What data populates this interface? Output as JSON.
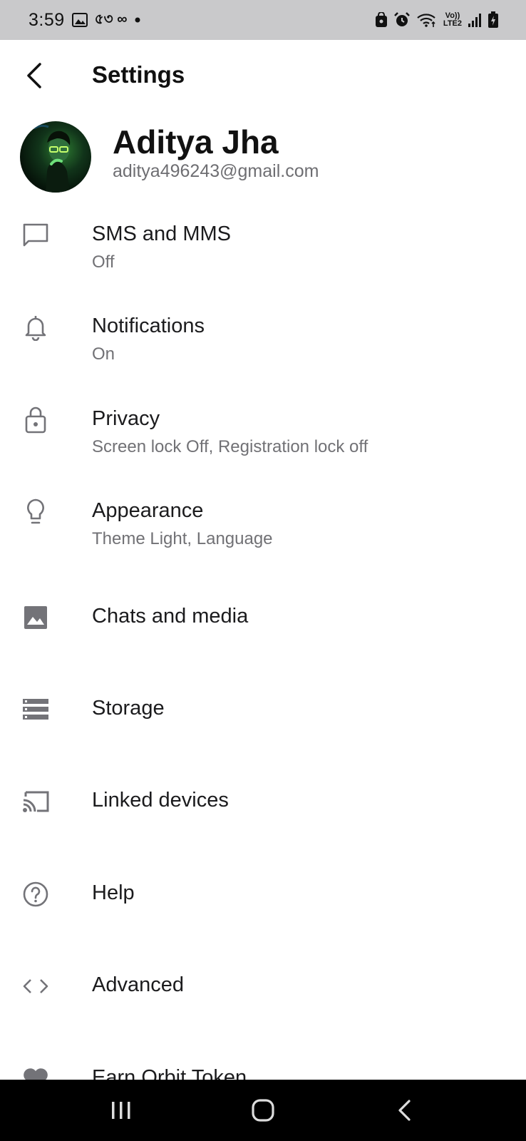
{
  "status_bar": {
    "time": "3:59",
    "misc_text": "৫৩ ∞",
    "network_top": "Vo))",
    "network_bottom": "LTE2"
  },
  "header": {
    "title": "Settings",
    "back_icon": "chevron-left-icon"
  },
  "profile": {
    "name": "Aditya Jha",
    "email": "aditya496243@gmail.com"
  },
  "settings": {
    "items": [
      {
        "icon": "message-icon",
        "title": "SMS and MMS",
        "subtitle": "Off"
      },
      {
        "icon": "bell-icon",
        "title": "Notifications",
        "subtitle": "On"
      },
      {
        "icon": "lock-icon",
        "title": "Privacy",
        "subtitle": "Screen lock Off, Registration lock off"
      },
      {
        "icon": "lightbulb-icon",
        "title": "Appearance",
        "subtitle": "Theme Light, Language"
      },
      {
        "icon": "image-icon",
        "title": "Chats and media",
        "subtitle": ""
      },
      {
        "icon": "storage-icon",
        "title": "Storage",
        "subtitle": ""
      },
      {
        "icon": "cast-icon",
        "title": "Linked devices",
        "subtitle": ""
      },
      {
        "icon": "help-icon",
        "title": "Help",
        "subtitle": ""
      },
      {
        "icon": "code-icon",
        "title": "Advanced",
        "subtitle": ""
      },
      {
        "icon": "heart-icon",
        "title": "Earn Orbit Token",
        "subtitle": ""
      }
    ]
  },
  "colors": {
    "status_bar_bg": "#c9c9cb",
    "icon_grey": "#737378",
    "subtitle_grey": "#717175",
    "nav_bar_bg": "#000000"
  }
}
